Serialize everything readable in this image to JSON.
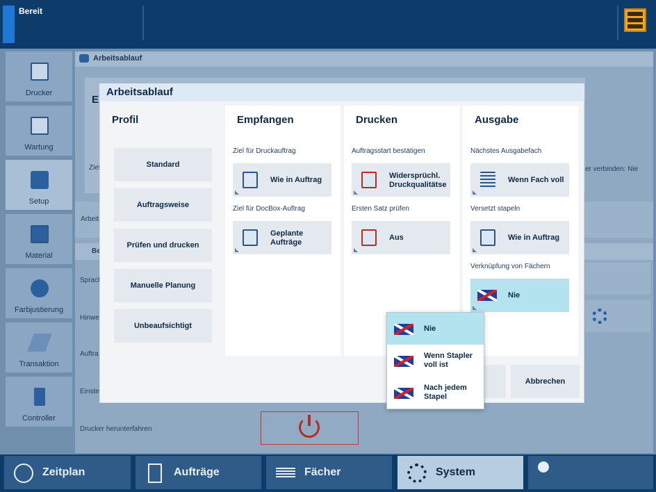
{
  "topbar": {
    "status": "Bereit"
  },
  "nav": {
    "items": [
      {
        "label": "Drucker"
      },
      {
        "label": "Wartung"
      },
      {
        "label": "Setup"
      },
      {
        "label": "Material"
      },
      {
        "label": "Farbjustierung"
      },
      {
        "label": "Transaktion"
      },
      {
        "label": "Controller"
      }
    ]
  },
  "background": {
    "header": "Arbeitsablauf",
    "row1": "Arbeits",
    "section2": "Be",
    "row2": "Sprach",
    "row3": "Hinwei",
    "row4": "Auftra",
    "row5": "Einstel",
    "row6": "Drucker herunterfahren",
    "peek1": "Er",
    "peek2": "Ziel",
    "peek3": "er verbinden: Nie"
  },
  "dialog": {
    "title": "Arbeitsablauf",
    "profile": {
      "heading": "Profil",
      "options": [
        "Standard",
        "Auftragsweise",
        "Prüfen und drucken",
        "Manuelle Planung",
        "Unbeaufsichtigt"
      ]
    },
    "receive": {
      "heading": "Empfangen",
      "label1": "Ziel für Druckauftrag",
      "value1": "Wie in Auftrag",
      "label2": "Ziel für DocBox-Auftrag",
      "value2a": "Geplante",
      "value2b": "Aufträge"
    },
    "print": {
      "heading": "Drucken",
      "label1": "Auftragsstart bestätigen",
      "value1a": "Widersprüchl.",
      "value1b": "Druckqualitätse",
      "label2": "Ersten Satz prüfen",
      "value2": "Aus"
    },
    "output": {
      "heading": "Ausgabe",
      "label1": "Nächstes Ausgabefach",
      "value1": "Wenn Fach voll",
      "label2": "Versetzt stapeln",
      "value2": "Wie in Auftrag",
      "label3": "Verknüpfung von Fächern",
      "value3": "Nie"
    },
    "cancel": "Abbrechen"
  },
  "dropdown": {
    "options": [
      {
        "a": "Nie",
        "b": ""
      },
      {
        "a": "Wenn Stapler",
        "b": "voll ist"
      },
      {
        "a": "Nach jedem",
        "b": "Stapel"
      }
    ],
    "selected": "Nie"
  },
  "bottom": {
    "tabs": [
      {
        "label": "Zeitplan"
      },
      {
        "label": "Aufträge"
      },
      {
        "label": "Fächer"
      },
      {
        "label": "System"
      }
    ],
    "active": "System"
  },
  "colors": {
    "topbar": "#0d3c6b",
    "accent": "#1f78d6",
    "selection": "#b3e3ef",
    "power": "#b82a26",
    "server": "#f5a623"
  }
}
